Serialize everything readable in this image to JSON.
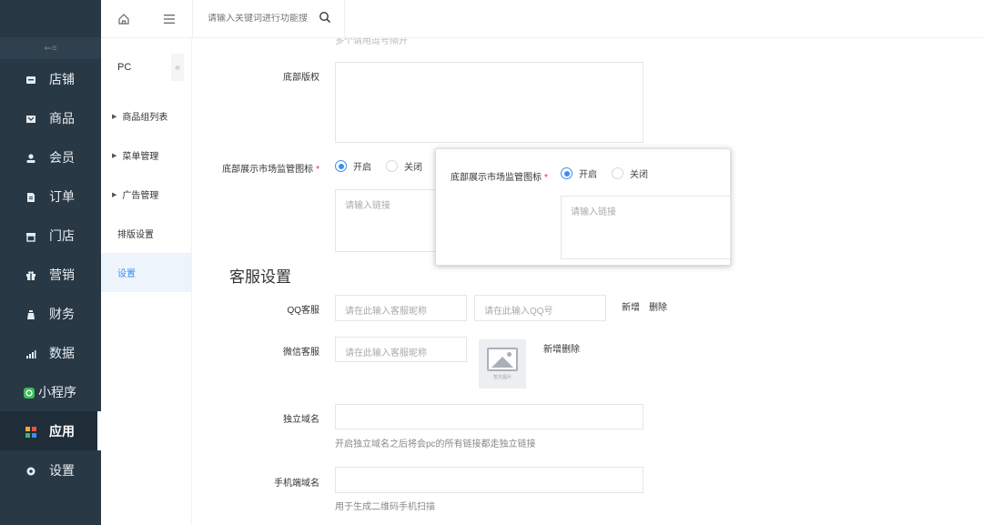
{
  "nav": {
    "collapse_icon": "collapse-icon",
    "items": [
      {
        "label": "店铺",
        "icon": "store-icon"
      },
      {
        "label": "商品",
        "icon": "goods-icon"
      },
      {
        "label": "会员",
        "icon": "member-icon"
      },
      {
        "label": "订单",
        "icon": "order-icon"
      },
      {
        "label": "门店",
        "icon": "shop-icon"
      },
      {
        "label": "营销",
        "icon": "gift-icon"
      },
      {
        "label": "财务",
        "icon": "finance-icon"
      },
      {
        "label": "数据",
        "icon": "chart-icon"
      },
      {
        "label": "小程序",
        "icon": "miniprogram-icon"
      },
      {
        "label": "应用",
        "icon": "apps-icon"
      },
      {
        "label": "设置",
        "icon": "gear-icon"
      }
    ]
  },
  "topbar": {
    "search_placeholder": "请输入关键词进行功能搜"
  },
  "subnav": {
    "title": "PC",
    "items": [
      {
        "label": "商品组列表"
      },
      {
        "label": "菜单管理"
      },
      {
        "label": "广告管理"
      },
      {
        "label": "排版设置"
      },
      {
        "label": "设置"
      }
    ]
  },
  "form": {
    "top_clipped": "多个请用逗号隔开",
    "copyright_label": "底部版权",
    "market_icon_label": "底部展示市场监管图标",
    "radio_on": "开启",
    "radio_off": "关闭",
    "link_placeholder": "请输入链接",
    "service_section": "客服设置",
    "qq_label": "QQ客服",
    "qq_nick_placeholder": "请在此输入客服昵称",
    "qq_num_placeholder": "请在此输入QQ号",
    "add": "新增",
    "delete": "删除",
    "wechat_label": "微信客服",
    "wechat_nick_placeholder": "请在此输入客服昵称",
    "no_image": "暂无图片",
    "domain_label": "独立域名",
    "domain_hint": "开启独立域名之后将会pc的所有链接都走独立链接",
    "mobile_label": "手机端域名",
    "mobile_hint": "用于生成二维码手机扫描"
  },
  "popup": {
    "label": "底部展示市场监管图标",
    "radio_on": "开启",
    "radio_off": "关闭",
    "link_placeholder": "请输入链接"
  },
  "colors": {
    "nav_bg": "#283845",
    "accent": "#3b8df1",
    "required": "#e23333"
  }
}
